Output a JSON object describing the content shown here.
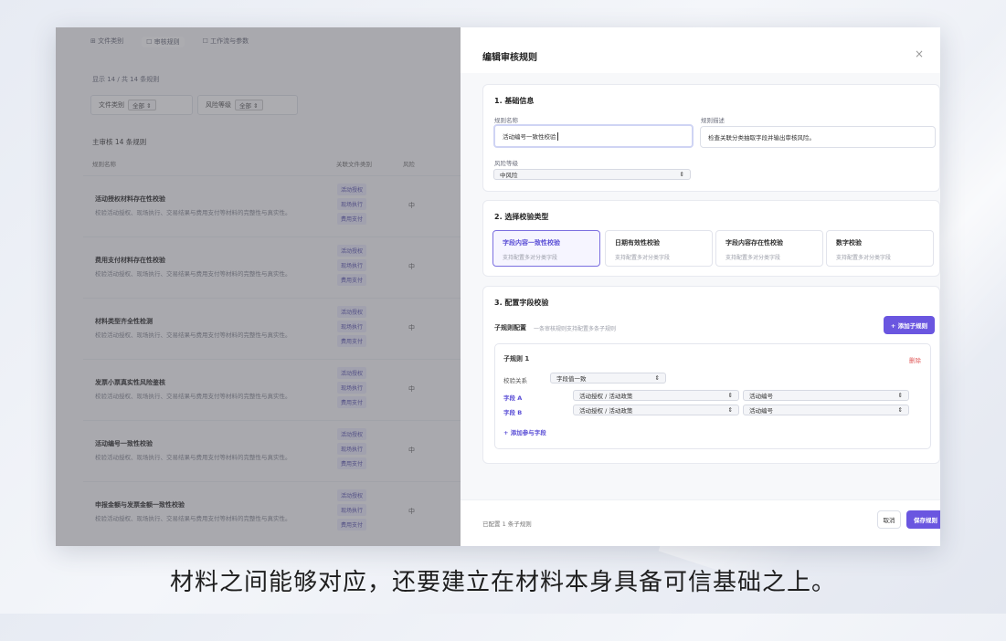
{
  "list": {
    "tabs": [
      "⊞ 文件类别",
      "☐ 审核规则",
      "☐ 工作流与参数"
    ],
    "count_text": "显示 14 / 共 14 条规则",
    "filters": [
      {
        "label": "文件类别",
        "value": "全部"
      },
      {
        "label": "风险等级",
        "value": "全部"
      }
    ],
    "section_title": "主审核   14 条规则",
    "headers": {
      "name": "规则名称",
      "category": "关联文件类别",
      "risk": "风险"
    },
    "rows": [
      {
        "name": "活动授权材料存在性校验",
        "desc": "校验活动授权、现场执行、交易结果与费用支付等材料的完整性与真实性。",
        "tags": [
          "活动授权",
          "现场执行",
          "费用支付"
        ],
        "risk": "中"
      },
      {
        "name": "费用支付材料存在性校验",
        "desc": "校验活动授权、现场执行、交易结果与费用支付等材料的完整性与真实性。",
        "tags": [
          "活动授权",
          "现场执行",
          "费用支付"
        ],
        "risk": "中"
      },
      {
        "name": "材料类型齐全性检测",
        "desc": "校验活动授权、现场执行、交易结果与费用支付等材料的完整性与真实性。",
        "tags": [
          "活动授权",
          "现场执行",
          "费用支付"
        ],
        "risk": "中"
      },
      {
        "name": "发票小票真实性风险鉴核",
        "desc": "校验活动授权、现场执行、交易结果与费用支付等材料的完整性与真实性。",
        "tags": [
          "活动授权",
          "现场执行",
          "费用支付"
        ],
        "risk": "中"
      },
      {
        "name": "活动编号一致性校验",
        "desc": "校验活动授权、现场执行、交易结果与费用支付等材料的完整性与真实性。",
        "tags": [
          "活动授权",
          "现场执行",
          "费用支付"
        ],
        "risk": "中"
      },
      {
        "name": "申报金额与发票金额一致性校验",
        "desc": "校验活动授权、现场执行、交易结果与费用支付等材料的完整性与真实性。",
        "tags": [
          "活动授权",
          "现场执行",
          "费用支付"
        ],
        "risk": "中"
      }
    ]
  },
  "drawer": {
    "title": "编辑审核规则",
    "close": "×",
    "basic": {
      "heading": "1. 基础信息",
      "name_label": "规则名称",
      "name_value": "活动编号一致性校验",
      "desc_label": "规则描述",
      "desc_value": "检查关联分类抽取字段并输出审核风险。",
      "risk_label": "风险等级",
      "risk_value": "中风险"
    },
    "types": {
      "heading": "2. 选择校验类型",
      "items": [
        {
          "title": "字段内容一致性校验",
          "sub": "支持配置多对分类字段"
        },
        {
          "title": "日期有效性校验",
          "sub": "支持配置多对分类字段"
        },
        {
          "title": "字段内容存在性校验",
          "sub": "支持配置多对分类字段"
        },
        {
          "title": "数字校验",
          "sub": "支持配置多对分类字段"
        }
      ]
    },
    "fields": {
      "heading": "3. 配置字段校验",
      "sub_config": "子规则配置",
      "sub_hint": "一条审核规则支持配置多条子规则",
      "add_sub": "+ 添加子规则",
      "subrule_title": "子规则 1",
      "delete": "删除",
      "relation_label": "校验关系",
      "relation_value": "字段值一致",
      "field_a": "字段 A",
      "field_b": "字段 B",
      "a_category": "活动授权 / 活动政策",
      "a_field": "活动编号",
      "b_category": "活动授权 / 活动政策",
      "b_field": "活动编号",
      "add_field": "+ 添加参与字段"
    },
    "footer": {
      "status": "已配置 1 条子规则",
      "cancel": "取消",
      "save": "保存规则"
    }
  },
  "caption": "材料之间能够对应，还要建立在材料本身具备可信基础之上。"
}
